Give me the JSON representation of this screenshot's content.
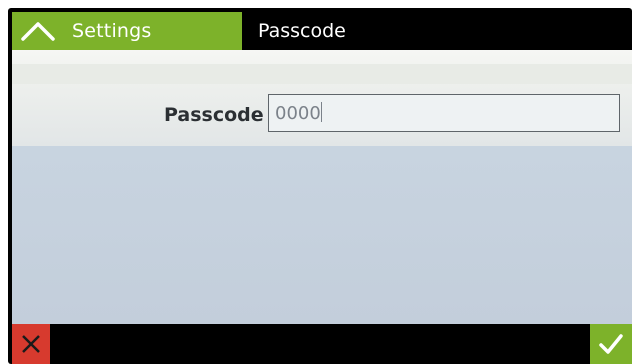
{
  "header": {
    "back_label": "Settings",
    "title": "Passcode",
    "back_icon": "chevron-up-icon"
  },
  "form": {
    "passcode_label": "Passcode",
    "passcode_value": "0000"
  },
  "footer": {
    "cancel_icon": "close-icon",
    "confirm_icon": "checkmark-icon"
  },
  "colors": {
    "accent_green": "#7db22a",
    "cancel_red": "#d73a2e",
    "content_blue": "#c6d2de"
  }
}
